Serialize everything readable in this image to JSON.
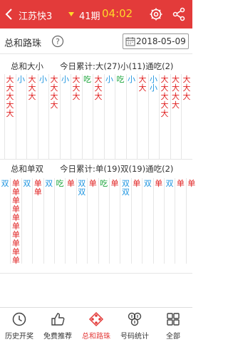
{
  "header": {
    "title": "江苏快3",
    "period": "41期",
    "countdown": "04:02"
  },
  "subbar": {
    "title": "总和路珠",
    "date": "2018-05-09"
  },
  "sections": [
    {
      "title": "总和大小",
      "today": "今日累计:大(27)小(11)通吃(2)",
      "columns": [
        [
          "大",
          "大",
          "大",
          "大",
          "大"
        ],
        [
          "小"
        ],
        [
          "大",
          "大",
          "大"
        ],
        [
          "小"
        ],
        [
          "大",
          "大",
          "大",
          "大"
        ],
        [
          "小"
        ],
        [
          "大",
          "大",
          "大"
        ],
        [
          "吃"
        ],
        [
          "大",
          "大",
          "大"
        ],
        [
          "小"
        ],
        [
          "吃"
        ],
        [
          "小"
        ],
        [
          "大",
          "大"
        ],
        [
          "小",
          "小"
        ],
        [
          "大",
          "大",
          "大",
          "大",
          "大"
        ],
        [
          "大",
          "大",
          "大",
          "大"
        ],
        [
          "大",
          "大",
          "大"
        ]
      ]
    },
    {
      "title": "总和单双",
      "today": "今日累计:单(19)双(19)通吃(2)",
      "columns": [
        [
          "双"
        ],
        [
          "单",
          "单",
          "单",
          "单",
          "单",
          "单",
          "单",
          "单",
          "单",
          "单"
        ],
        [
          "双"
        ],
        [
          "单",
          "单"
        ],
        [
          "双"
        ],
        [
          "吃"
        ],
        [
          "单"
        ],
        [
          "双",
          "双"
        ],
        [
          "单"
        ],
        [
          "吃"
        ],
        [
          "单"
        ],
        [
          "双",
          "双"
        ],
        [
          "单"
        ],
        [
          "双"
        ],
        [
          "单"
        ],
        [
          "双"
        ],
        [
          "单"
        ],
        [
          "单"
        ]
      ]
    }
  ],
  "tabs": [
    {
      "label": "历史开奖",
      "icon": "clock-icon"
    },
    {
      "label": "免费推荐",
      "icon": "thumbs-up-icon"
    },
    {
      "label": "总和路珠",
      "icon": "road-bead-icon"
    },
    {
      "label": "号码统计",
      "icon": "number-stats-icon"
    },
    {
      "label": "全部",
      "icon": "grid-icon"
    }
  ],
  "colors": {
    "brand": "#e33b3a",
    "countdown": "#ffd82a",
    "big": "#e02020",
    "small": "#2196e0",
    "draw": "#1aa53a"
  }
}
